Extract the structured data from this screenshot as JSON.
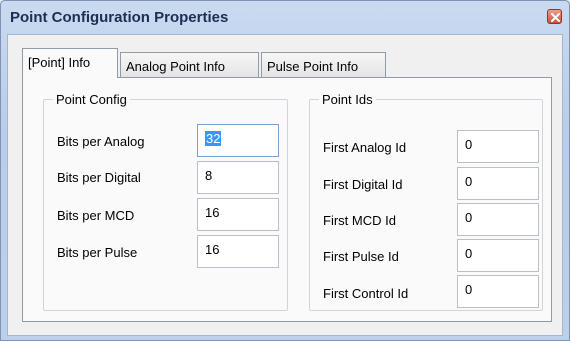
{
  "window": {
    "title": "Point Configuration Properties"
  },
  "tabs": [
    {
      "label": "[Point] Info",
      "active": true
    },
    {
      "label": "Analog Point Info",
      "active": false
    },
    {
      "label": "Pulse Point Info",
      "active": false
    }
  ],
  "point_config": {
    "title": "Point Config",
    "rows": [
      {
        "label": "Bits per Analog",
        "value": "32",
        "selected": true
      },
      {
        "label": "Bits per Digital",
        "value": "8"
      },
      {
        "label": "Bits per MCD",
        "value": "16"
      },
      {
        "label": "Bits per Pulse",
        "value": "16"
      }
    ]
  },
  "point_ids": {
    "title": "Point Ids",
    "rows": [
      {
        "label": "First Analog Id",
        "value": "0"
      },
      {
        "label": "First Digital Id",
        "value": "0"
      },
      {
        "label": "First MCD Id",
        "value": "0"
      },
      {
        "label": "First Pulse Id",
        "value": "0"
      },
      {
        "label": "First Control Id",
        "value": "0"
      }
    ]
  },
  "colors": {
    "selection": "#3399ff",
    "title_text": "#1b2f55",
    "close_button": "#c8533a"
  },
  "icons": {
    "close": "close-icon"
  }
}
